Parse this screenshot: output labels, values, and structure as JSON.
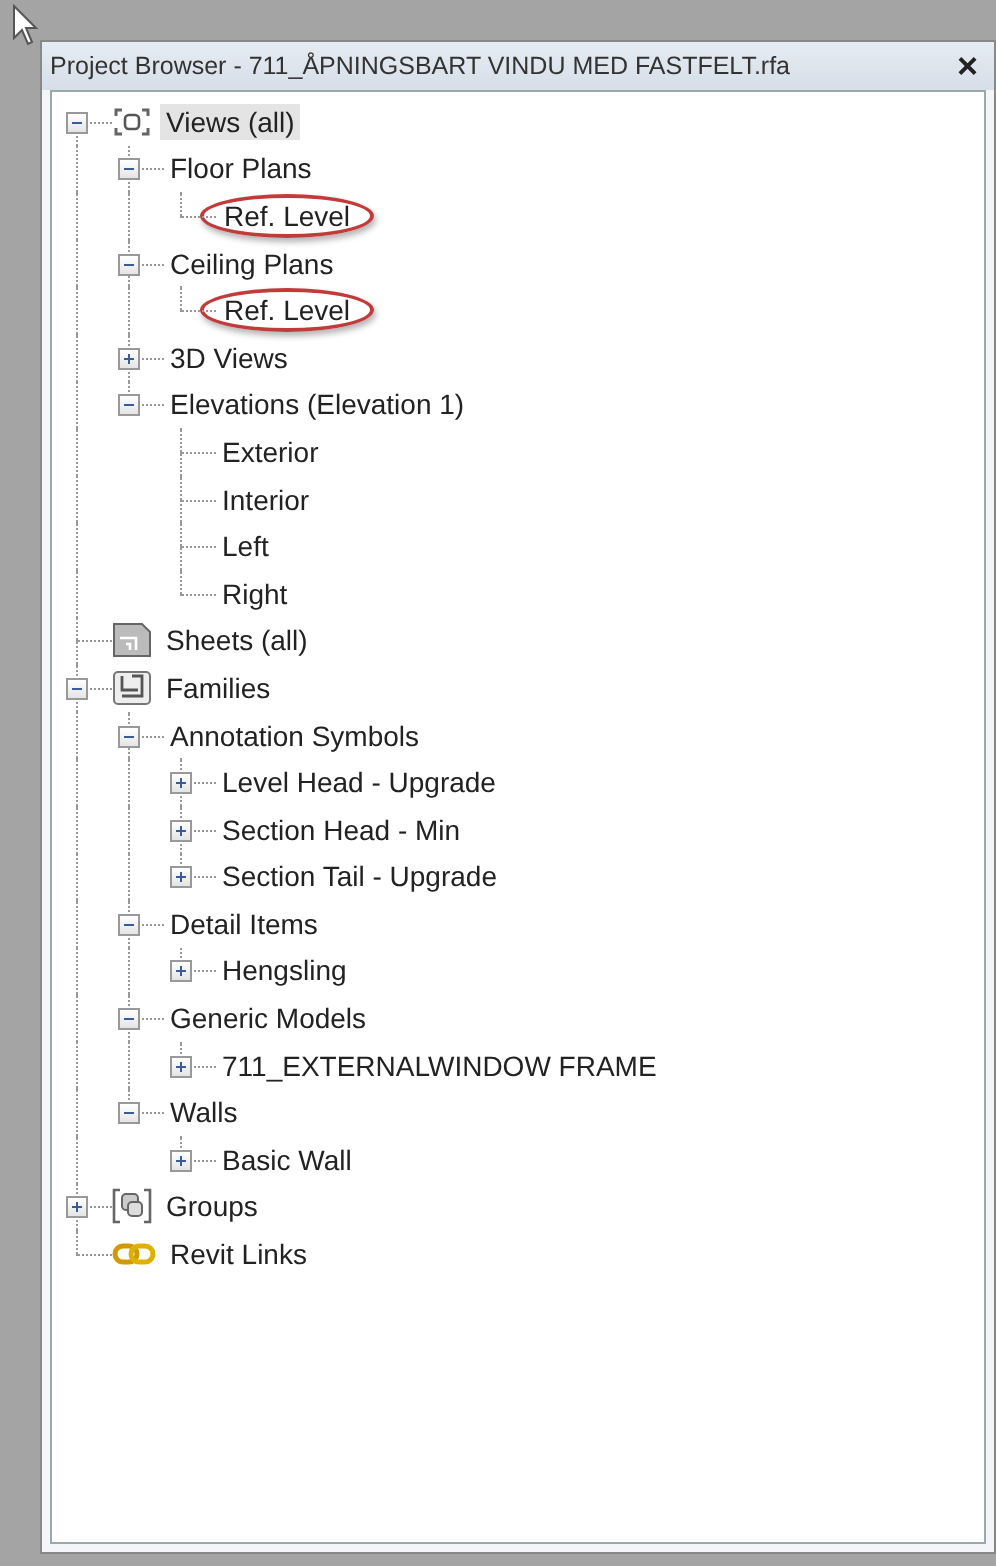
{
  "window": {
    "title": "Project Browser - 711_ÅPNINGSBART VINDU MED FASTFELT.rfa",
    "close": "×"
  },
  "tree": [
    {
      "label": "Views (all)",
      "kind": "branch",
      "expanded": true,
      "selected": true,
      "children": [
        {
          "label": "Floor Plans",
          "kind": "branch",
          "expanded": true,
          "selected": false,
          "children": [
            {
              "label": "Ref. Level",
              "kind": "leaf",
              "selected": false,
              "circled": true
            }
          ]
        },
        {
          "label": "Ceiling Plans",
          "kind": "branch",
          "expanded": true,
          "selected": false,
          "children": [
            {
              "label": "Ref. Level",
              "kind": "leaf",
              "selected": false,
              "circled": true
            }
          ]
        },
        {
          "label": "3D Views",
          "kind": "branch",
          "expanded": false,
          "selected": false
        },
        {
          "label": "Elevations (Elevation 1)",
          "kind": "branch",
          "expanded": true,
          "selected": false,
          "children": [
            {
              "label": "Exterior",
              "kind": "leaf",
              "selected": false,
              "circled": false
            },
            {
              "label": "Interior",
              "kind": "leaf",
              "selected": false,
              "circled": false
            },
            {
              "label": "Left",
              "kind": "leaf",
              "selected": false,
              "circled": false
            },
            {
              "label": "Right",
              "kind": "leaf",
              "selected": false,
              "circled": false
            }
          ]
        }
      ]
    },
    {
      "label": "Sheets (all)",
      "kind": "leaf",
      "selected": false,
      "circled": false
    },
    {
      "label": "Families",
      "kind": "branch",
      "expanded": true,
      "selected": false,
      "children": [
        {
          "label": "Annotation Symbols",
          "kind": "branch",
          "expanded": true,
          "selected": false,
          "children": [
            {
              "label": "Level Head - Upgrade",
              "kind": "branch",
              "expanded": false,
              "selected": false
            },
            {
              "label": "Section Head - Min",
              "kind": "branch",
              "expanded": false,
              "selected": false
            },
            {
              "label": "Section Tail - Upgrade",
              "kind": "branch",
              "expanded": false,
              "selected": false
            }
          ]
        },
        {
          "label": "Detail Items",
          "kind": "branch",
          "expanded": true,
          "selected": false,
          "children": [
            {
              "label": "Hengsling",
              "kind": "branch",
              "expanded": false,
              "selected": false
            }
          ]
        },
        {
          "label": "Generic Models",
          "kind": "branch",
          "expanded": true,
          "selected": false,
          "children": [
            {
              "label": "711_EXTERNALWINDOW FRAME",
              "kind": "branch",
              "expanded": false,
              "selected": false
            }
          ]
        },
        {
          "label": "Walls",
          "kind": "branch",
          "expanded": true,
          "selected": false,
          "children": [
            {
              "label": "Basic Wall",
              "kind": "branch",
              "expanded": false,
              "selected": false
            }
          ]
        }
      ]
    },
    {
      "label": "Groups",
      "kind": "branch",
      "expanded": false,
      "selected": false
    },
    {
      "label": "Revit Links",
      "kind": "leaf",
      "selected": false,
      "circled": false
    }
  ]
}
